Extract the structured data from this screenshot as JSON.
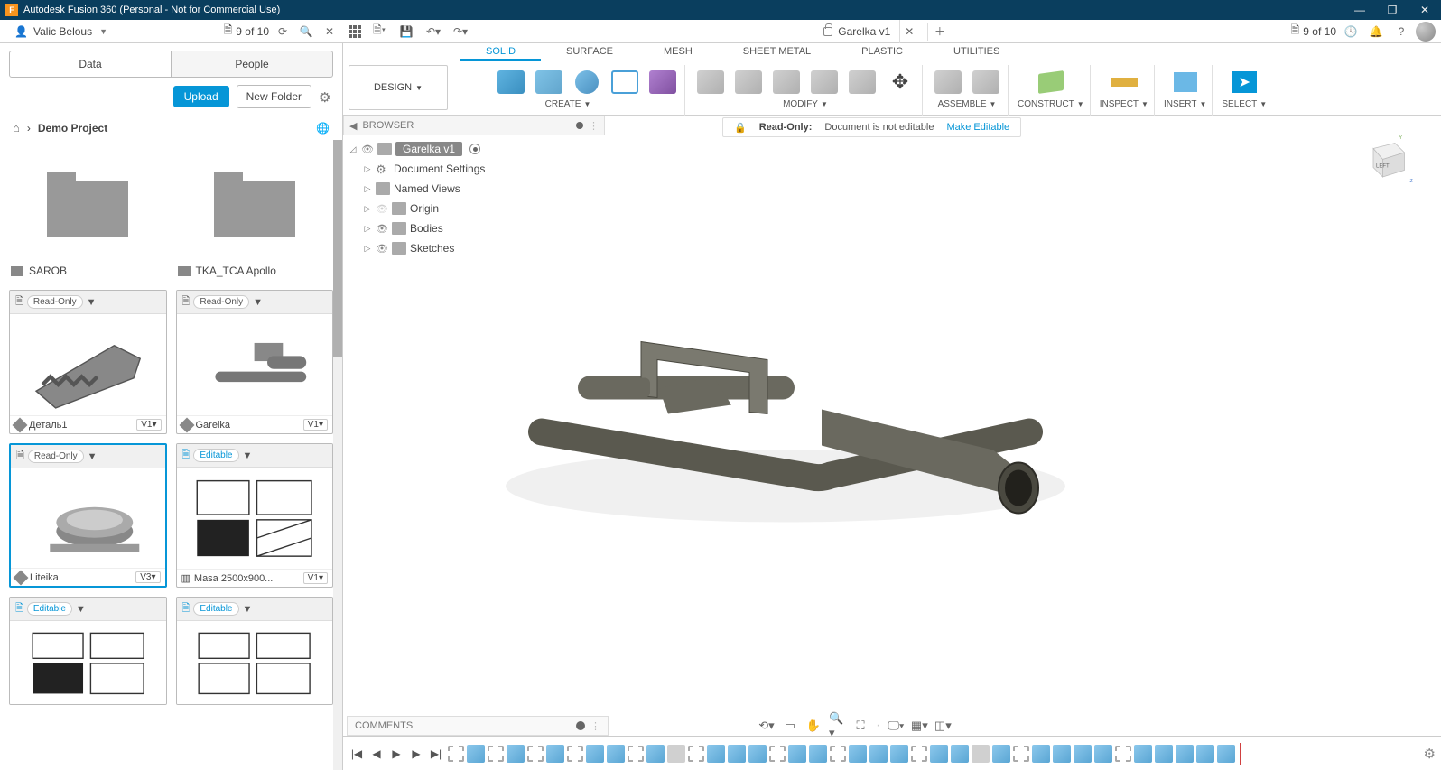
{
  "titlebar": {
    "app_title": "Autodesk Fusion 360 (Personal - Not for Commercial Use)"
  },
  "appbar": {
    "user_name": "Valic Belous",
    "left_count": "9 of 10",
    "right_count": "9 of 10",
    "doc_tab_title": "Garelka v1"
  },
  "ribbon": {
    "design_label": "DESIGN",
    "tabs": {
      "solid": "SOLID",
      "surface": "SURFACE",
      "mesh": "MESH",
      "sheet_metal": "SHEET METAL",
      "plastic": "PLASTIC",
      "utilities": "UTILITIES"
    },
    "groups": {
      "create": "CREATE",
      "modify": "MODIFY",
      "assemble": "ASSEMBLE",
      "construct": "CONSTRUCT",
      "inspect": "INSPECT",
      "insert": "INSERT",
      "select": "SELECT"
    }
  },
  "data_panel": {
    "tab_data": "Data",
    "tab_people": "People",
    "upload": "Upload",
    "new_folder": "New Folder",
    "breadcrumb": "Demo Project",
    "folders": [
      {
        "name": "SAROB"
      },
      {
        "name": "TKA_TCA Apollo"
      }
    ],
    "designs": [
      {
        "status": "Read-Only",
        "name": "Деталь1",
        "version": "V1"
      },
      {
        "status": "Read-Only",
        "name": "Garelka",
        "version": "V1"
      },
      {
        "status": "Read-Only",
        "name": "Liteika",
        "version": "V3"
      },
      {
        "status": "Editable",
        "name": "Masa 2500x900...",
        "version": "V1"
      },
      {
        "status": "Editable",
        "name": "",
        "version": ""
      },
      {
        "status": "Editable",
        "name": "",
        "version": ""
      }
    ]
  },
  "browser": {
    "header": "BROWSER",
    "root": "Garelka v1",
    "items": {
      "doc_settings": "Document Settings",
      "named_views": "Named Views",
      "origin": "Origin",
      "bodies": "Bodies",
      "sketches": "Sketches"
    }
  },
  "readonly_bar": {
    "label": "Read-Only:",
    "message": "Document is not editable",
    "link": "Make Editable"
  },
  "viewcube": {
    "face": "LEFT"
  },
  "comments": {
    "title": "COMMENTS"
  }
}
